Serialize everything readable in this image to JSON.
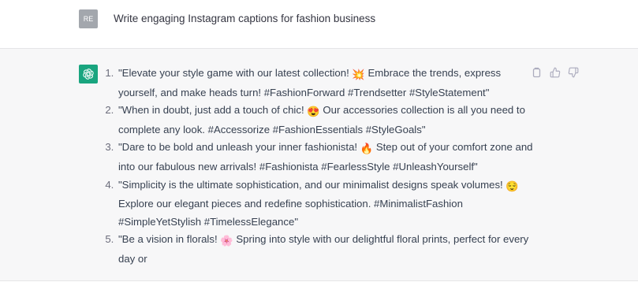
{
  "user": {
    "avatar_initials": "RE",
    "message": "Write engaging Instagram captions for fashion business"
  },
  "assistant": {
    "avatar_icon": "openai-logo-icon",
    "accent_color": "#19a57f",
    "items": [
      {
        "before": "\"Elevate your style game with our latest collection! ",
        "emoji": "💥",
        "after": " Embrace the trends, express yourself, and make heads turn! #FashionForward #Trendsetter #StyleStatement\""
      },
      {
        "before": "\"When in doubt, just add a touch of chic! ",
        "emoji": "😍",
        "after": " Our accessories collection is all you need to complete any look. #Accessorize #FashionEssentials #StyleGoals\""
      },
      {
        "before": "\"Dare to be bold and unleash your inner fashionista! ",
        "emoji": "🔥",
        "after": " Step out of your comfort zone and into our fabulous new arrivals! #Fashionista #FearlessStyle #UnleashYourself\""
      },
      {
        "before": "\"Simplicity is the ultimate sophistication, and our minimalist designs speak volumes! ",
        "emoji": "😌",
        "after": " Explore our elegant pieces and redefine sophistication. #MinimalistFashion #SimpleYetStylish #TimelessElegance\""
      },
      {
        "before": "\"Be a vision in florals! ",
        "emoji": "🌸",
        "after": " Spring into style with our delightful floral prints, perfect for every day or"
      }
    ],
    "actions": [
      "copy-icon",
      "thumbs-up-icon",
      "thumbs-down-icon"
    ]
  }
}
